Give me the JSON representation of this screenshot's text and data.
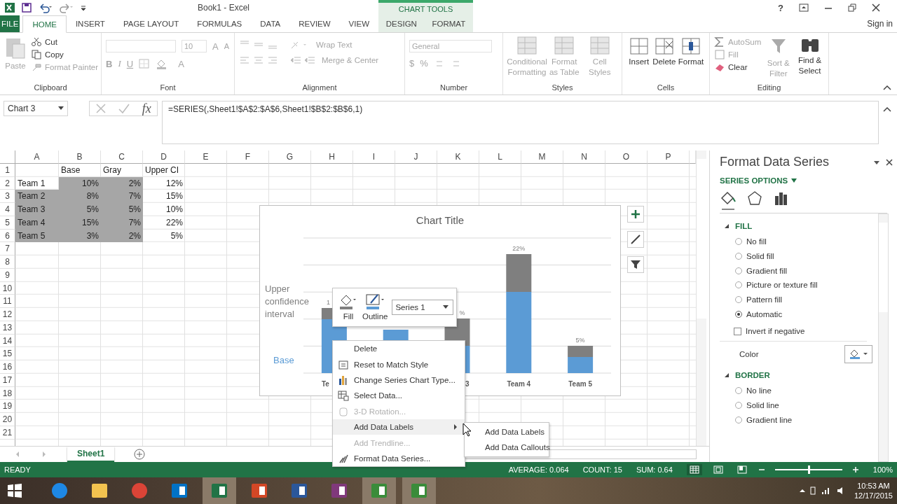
{
  "title_bar": {
    "title": "Book1 - Excel",
    "context_group": "CHART TOOLS",
    "help": "?"
  },
  "tabs": [
    {
      "label": "FILE",
      "kind": "file",
      "selected": false
    },
    {
      "label": "HOME",
      "kind": "normal",
      "selected": true
    },
    {
      "label": "INSERT",
      "kind": "normal",
      "selected": false
    },
    {
      "label": "PAGE LAYOUT",
      "kind": "normal",
      "selected": false
    },
    {
      "label": "FORMULAS",
      "kind": "normal",
      "selected": false
    },
    {
      "label": "DATA",
      "kind": "normal",
      "selected": false
    },
    {
      "label": "REVIEW",
      "kind": "normal",
      "selected": false
    },
    {
      "label": "VIEW",
      "kind": "normal",
      "selected": false
    },
    {
      "label": "DESIGN",
      "kind": "context",
      "selected": false
    },
    {
      "label": "FORMAT",
      "kind": "context",
      "selected": false
    }
  ],
  "sign_in": "Sign in",
  "ribbon": {
    "clipboard": {
      "label": "Clipboard",
      "paste": {
        "label": "Paste",
        "disabled": true
      },
      "actions": [
        {
          "kind": "cut",
          "label": "Cut",
          "disabled": false
        },
        {
          "kind": "copy",
          "label": "Copy",
          "disabled": false
        },
        {
          "kind": "painter",
          "label": "Format Painter",
          "disabled": true
        }
      ]
    },
    "font": {
      "label": "Font",
      "disabled": true,
      "size": "10",
      "grow": "A",
      "shrink": "A",
      "styles": [
        "B",
        "I",
        "U"
      ],
      "font_color_button": "A"
    },
    "alignment": {
      "label": "Alignment",
      "disabled": true,
      "wrap": "Wrap Text",
      "merge": "Merge & Center"
    },
    "number": {
      "label": "Number",
      "disabled": true,
      "format": "General",
      "currency": "$",
      "percent": "%"
    },
    "styles": {
      "label": "Styles",
      "items": [
        {
          "label": "Conditional Formatting",
          "disabled": true
        },
        {
          "label": "Format as Table",
          "disabled": true
        },
        {
          "label": "Cell Styles",
          "disabled": true
        }
      ]
    },
    "cells": {
      "label": "Cells",
      "items": [
        {
          "kind": "insert",
          "label": "Insert",
          "disabled": false
        },
        {
          "kind": "delete",
          "label": "Delete",
          "disabled": false
        },
        {
          "kind": "format",
          "label": "Format",
          "disabled": false
        }
      ]
    },
    "editing": {
      "label": "Editing",
      "small": [
        {
          "kind": "autosum",
          "label": "AutoSum",
          "disabled": true
        },
        {
          "kind": "fill",
          "label": "Fill",
          "disabled": true
        },
        {
          "kind": "clear",
          "label": "Clear",
          "disabled": false
        }
      ],
      "large": [
        {
          "kind": "sort",
          "label": "Sort & Filter",
          "disabled": true
        },
        {
          "kind": "find",
          "label": "Find & Select",
          "disabled": false
        }
      ]
    }
  },
  "formula_bar": {
    "name_box": "Chart 3",
    "fx": "fx",
    "formula": "=SERIES(,Sheet1!$A$2:$A$6,Sheet1!$B$2:$B$6,1)"
  },
  "sheet": {
    "columns": [
      "A",
      "B",
      "C",
      "D",
      "E",
      "F",
      "G",
      "H",
      "I",
      "J",
      "K",
      "L",
      "M",
      "N",
      "O",
      "P"
    ],
    "rows": [
      {
        "number": "1",
        "cells": [
          null,
          {
            "text": "Base",
            "kind": "text",
            "selected": false
          },
          {
            "text": "Gray",
            "kind": "text",
            "selected": false
          },
          {
            "text": "Upper CI",
            "kind": "text",
            "selected": false
          }
        ]
      },
      {
        "number": "2",
        "cells": [
          {
            "text": "Team 1",
            "kind": "text",
            "selected": false
          },
          {
            "text": "10%",
            "kind": "number",
            "selected": true
          },
          {
            "text": "2%",
            "kind": "number",
            "selected": true
          },
          {
            "text": "12%",
            "kind": "number",
            "selected": false
          }
        ]
      },
      {
        "number": "3",
        "cells": [
          {
            "text": "Team 2",
            "kind": "text",
            "selected": true
          },
          {
            "text": "8%",
            "kind": "number",
            "selected": true
          },
          {
            "text": "7%",
            "kind": "number",
            "selected": true
          },
          {
            "text": "15%",
            "kind": "number",
            "selected": false
          }
        ]
      },
      {
        "number": "4",
        "cells": [
          {
            "text": "Team 3",
            "kind": "text",
            "selected": true
          },
          {
            "text": "5%",
            "kind": "number",
            "selected": true
          },
          {
            "text": "5%",
            "kind": "number",
            "selected": true
          },
          {
            "text": "10%",
            "kind": "number",
            "selected": false
          }
        ]
      },
      {
        "number": "5",
        "cells": [
          {
            "text": "Team 4",
            "kind": "text",
            "selected": true
          },
          {
            "text": "15%",
            "kind": "number",
            "selected": true
          },
          {
            "text": "7%",
            "kind": "number",
            "selected": true
          },
          {
            "text": "22%",
            "kind": "number",
            "selected": false
          }
        ]
      },
      {
        "number": "6",
        "cells": [
          {
            "text": "Team 5",
            "kind": "text",
            "selected": true
          },
          {
            "text": "3%",
            "kind": "number",
            "selected": true
          },
          {
            "text": "2%",
            "kind": "number",
            "selected": true
          },
          {
            "text": "5%",
            "kind": "number",
            "selected": false
          }
        ]
      },
      {
        "number": "7"
      },
      {
        "number": "8"
      },
      {
        "number": "9"
      },
      {
        "number": "10"
      },
      {
        "number": "11"
      },
      {
        "number": "12"
      },
      {
        "number": "13"
      },
      {
        "number": "14"
      },
      {
        "number": "15"
      },
      {
        "number": "16"
      },
      {
        "number": "17"
      },
      {
        "number": "18"
      },
      {
        "number": "19"
      },
      {
        "number": "20"
      },
      {
        "number": "21"
      }
    ],
    "tabs": [
      {
        "label": "Sheet1",
        "selected": true
      }
    ]
  },
  "chart": {
    "title": "Chart Title",
    "series": [
      {
        "name": "Upper confidence interval",
        "color": "#7f7f7f"
      },
      {
        "name": "Base",
        "color": "#5b9bd5"
      }
    ],
    "columns": [
      {
        "axis_label": "Te",
        "value_label": "1"
      },
      {},
      {
        "axis_label": "3",
        "value_label": "%"
      },
      {
        "axis_label": "Team 4",
        "value_label": "22%"
      },
      {
        "axis_label": "Team 5",
        "value_label": "5%"
      }
    ]
  },
  "mini_toolbar": {
    "fill": "Fill",
    "outline": "Outline",
    "series": "Series 1"
  },
  "context_menu": [
    {
      "label": "Delete",
      "kind": "plain",
      "disabled": false,
      "selected": false,
      "submenu": false
    },
    {
      "label": "Reset to Match Style",
      "kind": "reset",
      "disabled": false,
      "selected": false,
      "submenu": false
    },
    {
      "label": "Change Series Chart Type...",
      "kind": "chart",
      "disabled": false,
      "selected": false,
      "submenu": false
    },
    {
      "label": "Select Data...",
      "kind": "data",
      "disabled": false,
      "selected": false,
      "submenu": false
    },
    {
      "label": "3-D Rotation...",
      "kind": "rotation",
      "disabled": true,
      "selected": false,
      "submenu": false
    },
    {
      "label": "Add Data Labels",
      "kind": "plain",
      "disabled": false,
      "selected": true,
      "submenu": true
    },
    {
      "label": "Add Trendline...",
      "kind": "plain",
      "disabled": true,
      "selected": false,
      "submenu": false
    },
    {
      "label": "Format Data Series...",
      "kind": "format",
      "disabled": false,
      "selected": false,
      "submenu": false
    }
  ],
  "submenu": [
    "Add Data Labels",
    "Add Data Callouts"
  ],
  "pane": {
    "title": "Format Data Series",
    "options_label": "SERIES OPTIONS",
    "icon_tabs": [
      {
        "kind": "fill",
        "selected": true
      },
      {
        "kind": "effects",
        "selected": false
      },
      {
        "kind": "series",
        "selected": false
      }
    ],
    "sections": [
      {
        "title": "FILL",
        "expanded": true,
        "options": [
          {
            "kind": "radio",
            "label": "No fill",
            "selected": false
          },
          {
            "kind": "radio",
            "label": "Solid fill",
            "selected": false
          },
          {
            "kind": "radio",
            "label": "Gradient fill",
            "selected": false
          },
          {
            "kind": "radio",
            "label": "Picture or texture fill",
            "selected": false
          },
          {
            "kind": "radio",
            "label": "Pattern fill",
            "selected": false
          },
          {
            "kind": "radio",
            "label": "Automatic",
            "selected": true
          },
          {
            "kind": "checkbox",
            "label": "Invert if negative",
            "checked": false
          },
          {
            "kind": "color",
            "label": "Color"
          }
        ]
      },
      {
        "title": "BORDER",
        "expanded": true,
        "options": [
          {
            "kind": "radio",
            "label": "No line",
            "selected": false
          },
          {
            "kind": "radio",
            "label": "Solid line",
            "selected": false
          },
          {
            "kind": "radio",
            "label": "Gradient line",
            "selected": false
          }
        ]
      }
    ]
  },
  "status_bar": {
    "mode": "READY",
    "stats": [
      "AVERAGE: 0.064",
      "COUNT: 15",
      "SUM: 0.64"
    ],
    "views": [
      {
        "kind": "normal",
        "selected": true
      },
      {
        "kind": "layout",
        "selected": false
      },
      {
        "kind": "break",
        "selected": false
      }
    ],
    "zoom": {
      "level": 0.5,
      "label": "100%"
    }
  },
  "taskbar": {
    "apps": [
      {
        "kind": "ie",
        "selected": false
      },
      {
        "kind": "folder",
        "selected": false
      },
      {
        "kind": "chrome",
        "selected": false
      },
      {
        "kind": "outlook",
        "selected": false
      },
      {
        "kind": "excel",
        "selected": true
      },
      {
        "kind": "powerpoint",
        "selected": false
      },
      {
        "kind": "word",
        "selected": false
      },
      {
        "kind": "onenote",
        "selected": false
      },
      {
        "kind": "camtasia",
        "selected": true
      },
      {
        "kind": "camtasia",
        "selected": true
      }
    ],
    "time": "10:53 AM",
    "date": "12/17/2015"
  }
}
